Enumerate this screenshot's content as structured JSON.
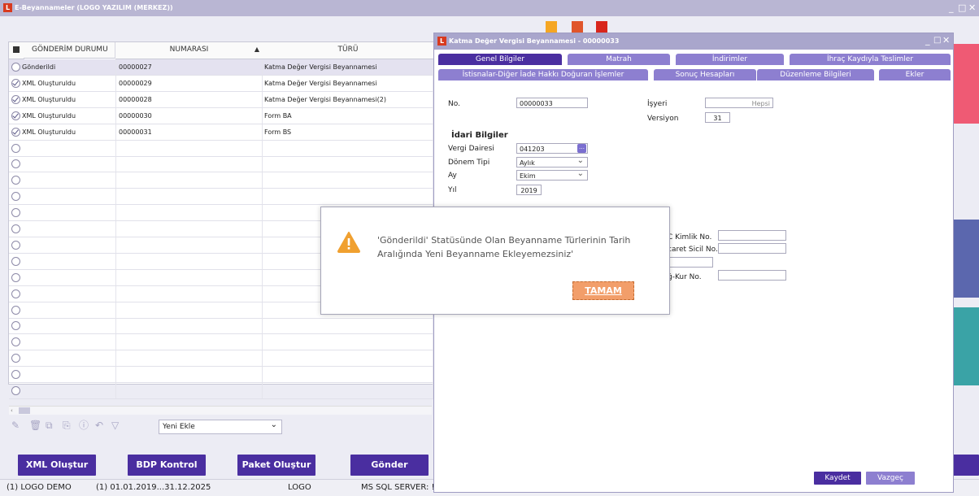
{
  "main_window": {
    "title": "E-Beyannameler (LOGO YAZILIM (MERKEZ))",
    "controls": {
      "minimize": "_",
      "maximize": "□",
      "close": "✕"
    }
  },
  "grid": {
    "columns": [
      "GÖNDERİM DURUMU",
      "NUMARASI",
      "TÜRÜ"
    ],
    "rows": [
      {
        "status": "Gönderildi",
        "checked": false,
        "number": "00000027",
        "type": "Katma Değer Vergisi Beyannamesi"
      },
      {
        "status": "XML Oluşturuldu",
        "checked": true,
        "number": "00000029",
        "type": "Katma Değer Vergisi Beyannamesi"
      },
      {
        "status": "XML Oluşturuldu",
        "checked": true,
        "number": "00000028",
        "type": "Katma Değer Vergisi Beyannamesi(2)"
      },
      {
        "status": "XML Oluşturuldu",
        "checked": true,
        "number": "00000030",
        "type": "Form BA"
      },
      {
        "status": "XML Oluşturuldu",
        "checked": true,
        "number": "00000031",
        "type": "Form BS"
      }
    ]
  },
  "toolbar": {
    "yeni_ekle": "Yeni Ekle"
  },
  "buttons": {
    "xml": "XML Oluştur",
    "bdp": "BDP Kontrol",
    "paket": "Paket Oluştur",
    "gonder": "Gönder"
  },
  "status_bar": {
    "firm": "(1) LOGO DEMO",
    "period": "(1) 01.01.2019...31.12.2025",
    "user": "LOGO",
    "server": "MS SQL SERVER: !"
  },
  "child_window": {
    "title": "Katma Değer Vergisi Beyannamesi - 00000033",
    "tabs_row1": [
      "Genel Bilgiler",
      "Matrah",
      "İndirimler",
      "İhraç Kaydıyla Teslimler"
    ],
    "tabs_row2": [
      "İstisnalar-Diğer İade Hakkı Doğuran İşlemler",
      "Sonuç Hesapları",
      "Düzenleme Bilgileri",
      "Ekler"
    ],
    "no_label": "No.",
    "no_value": "00000033",
    "isyeri_label": "İşyeri",
    "isyeri_value": "Hepsi",
    "versiyon_label": "Versiyon",
    "versiyon_value": "31",
    "idari_heading": "İdari Bilgiler",
    "vergi_dairesi_label": "Vergi Dairesi",
    "vergi_dairesi_value": "041203",
    "donem_tipi_label": "Dönem Tipi",
    "donem_tipi_value": "Aylık",
    "ay_label": "Ay",
    "ay_value": "Ekim",
    "yil_label": "Yıl",
    "yil_value": "2019",
    "kimlik_label": "C Kimlik No.",
    "ticaret_label": "caret Sicil No.",
    "bagkur_label": "ğ-Kur No.",
    "kaydet": "Kaydet",
    "vazgec": "Vazgeç"
  },
  "dialog": {
    "message_line1": "'Gönderildi' Statüsünde Olan Beyanname Türlerinin Tarih",
    "message_line2": "Aralığında Yeni Beyanname Ekleyemezsiniz'",
    "ok": "TAMAM"
  },
  "colors": {
    "accent": "#4a2ea0",
    "title_bar": "#b9b6d3",
    "tab_inactive": "#8d7fd0",
    "ok_button": "#f29e6a",
    "warning": "#f0a030"
  }
}
